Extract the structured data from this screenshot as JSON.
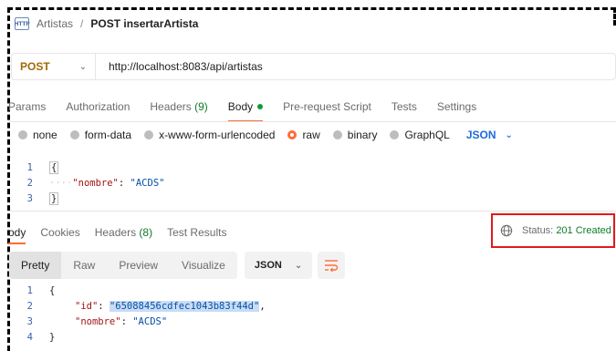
{
  "breadcrumb": {
    "icon": "http-icon",
    "icon_text": "HTTP",
    "parent": "Artistas",
    "separator": "/",
    "current": "POST insertarArtista"
  },
  "request": {
    "method": "POST",
    "url": "http://localhost:8083/api/artistas",
    "tabs": [
      {
        "label": "Params"
      },
      {
        "label": "Authorization"
      },
      {
        "label": "Headers",
        "count": "(9)"
      },
      {
        "label": "Body",
        "active": true
      },
      {
        "label": "Pre-request Script"
      },
      {
        "label": "Tests"
      },
      {
        "label": "Settings"
      }
    ],
    "body_types": [
      "none",
      "form-data",
      "x-www-form-urlencoded",
      "raw",
      "binary",
      "GraphQL"
    ],
    "selected_body_type": "raw",
    "format": "JSON",
    "code_lines": [
      {
        "n": "1",
        "text": "{"
      },
      {
        "n": "2",
        "text": "····\"nombre\": \"ACDS\""
      },
      {
        "n": "3",
        "text": "}"
      }
    ]
  },
  "response": {
    "tabs": [
      {
        "label": "ody",
        "active": true
      },
      {
        "label": "Cookies"
      },
      {
        "label": "Headers",
        "count": "(8)"
      },
      {
        "label": "Test Results"
      }
    ],
    "status_label": "Status:",
    "status_value": "201 Created",
    "view_modes": [
      "Pretty",
      "Raw",
      "Preview",
      "Visualize"
    ],
    "active_view_mode": "Pretty",
    "format": "JSON",
    "code_lines": [
      {
        "n": "1",
        "text": "{"
      },
      {
        "n": "2",
        "key": "\"id\"",
        "value": "\"65088456cdfec1043b83f44d\""
      },
      {
        "n": "3",
        "key": "\"nombre\"",
        "value": "\"ACDS\""
      },
      {
        "n": "4",
        "text": "}"
      }
    ]
  },
  "colors": {
    "accent": "#ff6c37",
    "method": "#a36a00",
    "success": "#0f7b28",
    "link": "#1c6ce0",
    "highlight_border": "#e11b1b"
  }
}
